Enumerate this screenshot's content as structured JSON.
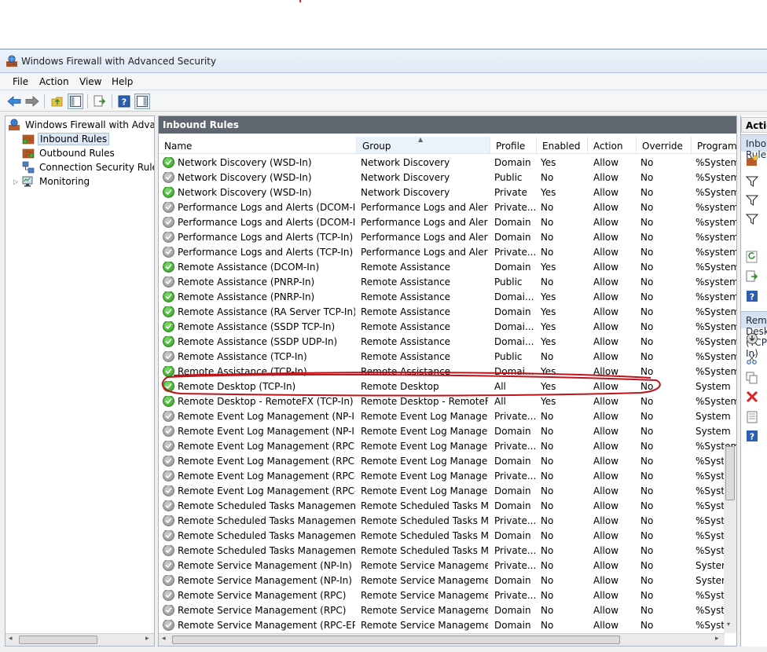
{
  "window": {
    "title": "Windows Firewall with Advanced Security"
  },
  "menu": [
    "File",
    "Action",
    "View",
    "Help"
  ],
  "tree": {
    "root": "Windows Firewall with Advanced Security on Local Computer",
    "items": [
      "Inbound Rules",
      "Outbound Rules",
      "Connection Security Rules",
      "Monitoring"
    ]
  },
  "main": {
    "header": "Inbound Rules",
    "columns": [
      "Name",
      "Group",
      "Profile",
      "Enabled",
      "Action",
      "Override",
      "Program"
    ]
  },
  "rows": [
    {
      "name": "Network Discovery (WSD-In)",
      "group": "Network Discovery",
      "profile": "Domain",
      "enabled": "Yes",
      "action": "Allow",
      "override": "No",
      "program": "%System"
    },
    {
      "name": "Network Discovery (WSD-In)",
      "group": "Network Discovery",
      "profile": "Public",
      "enabled": "No",
      "action": "Allow",
      "override": "No",
      "program": "%System"
    },
    {
      "name": "Network Discovery (WSD-In)",
      "group": "Network Discovery",
      "profile": "Private",
      "enabled": "Yes",
      "action": "Allow",
      "override": "No",
      "program": "%System"
    },
    {
      "name": "Performance Logs and Alerts (DCOM-In)",
      "group": "Performance Logs and Alerts",
      "profile": "Private...",
      "enabled": "No",
      "action": "Allow",
      "override": "No",
      "program": "%system"
    },
    {
      "name": "Performance Logs and Alerts (DCOM-In)",
      "group": "Performance Logs and Alerts",
      "profile": "Domain",
      "enabled": "No",
      "action": "Allow",
      "override": "No",
      "program": "%system"
    },
    {
      "name": "Performance Logs and Alerts (TCP-In)",
      "group": "Performance Logs and Alerts",
      "profile": "Domain",
      "enabled": "No",
      "action": "Allow",
      "override": "No",
      "program": "%system"
    },
    {
      "name": "Performance Logs and Alerts (TCP-In)",
      "group": "Performance Logs and Alerts",
      "profile": "Private...",
      "enabled": "No",
      "action": "Allow",
      "override": "No",
      "program": "%system"
    },
    {
      "name": "Remote Assistance (DCOM-In)",
      "group": "Remote Assistance",
      "profile": "Domain",
      "enabled": "Yes",
      "action": "Allow",
      "override": "No",
      "program": "%System"
    },
    {
      "name": "Remote Assistance (PNRP-In)",
      "group": "Remote Assistance",
      "profile": "Public",
      "enabled": "No",
      "action": "Allow",
      "override": "No",
      "program": "%system"
    },
    {
      "name": "Remote Assistance (PNRP-In)",
      "group": "Remote Assistance",
      "profile": "Domai...",
      "enabled": "Yes",
      "action": "Allow",
      "override": "No",
      "program": "%system"
    },
    {
      "name": "Remote Assistance (RA Server TCP-In)",
      "group": "Remote Assistance",
      "profile": "Domain",
      "enabled": "Yes",
      "action": "Allow",
      "override": "No",
      "program": "%System"
    },
    {
      "name": "Remote Assistance (SSDP TCP-In)",
      "group": "Remote Assistance",
      "profile": "Domai...",
      "enabled": "Yes",
      "action": "Allow",
      "override": "No",
      "program": "%System"
    },
    {
      "name": "Remote Assistance (SSDP UDP-In)",
      "group": "Remote Assistance",
      "profile": "Domai...",
      "enabled": "Yes",
      "action": "Allow",
      "override": "No",
      "program": "%System"
    },
    {
      "name": "Remote Assistance (TCP-In)",
      "group": "Remote Assistance",
      "profile": "Public",
      "enabled": "No",
      "action": "Allow",
      "override": "No",
      "program": "%System"
    },
    {
      "name": "Remote Assistance (TCP-In)",
      "group": "Remote Assistance",
      "profile": "Domai...",
      "enabled": "Yes",
      "action": "Allow",
      "override": "No",
      "program": "%System"
    },
    {
      "name": "Remote Desktop (TCP-In)",
      "group": "Remote Desktop",
      "profile": "All",
      "enabled": "Yes",
      "action": "Allow",
      "override": "No",
      "program": "System"
    },
    {
      "name": "Remote Desktop - RemoteFX (TCP-In)",
      "group": "Remote Desktop - RemoteFX",
      "profile": "All",
      "enabled": "Yes",
      "action": "Allow",
      "override": "No",
      "program": "%System"
    },
    {
      "name": "Remote Event Log Management (NP-In)",
      "group": "Remote Event Log Manage...",
      "profile": "Private...",
      "enabled": "No",
      "action": "Allow",
      "override": "No",
      "program": "System"
    },
    {
      "name": "Remote Event Log Management (NP-In)",
      "group": "Remote Event Log Manage...",
      "profile": "Domain",
      "enabled": "No",
      "action": "Allow",
      "override": "No",
      "program": "System"
    },
    {
      "name": "Remote Event Log Management (RPC)",
      "group": "Remote Event Log Manage...",
      "profile": "Private...",
      "enabled": "No",
      "action": "Allow",
      "override": "No",
      "program": "%System"
    },
    {
      "name": "Remote Event Log Management (RPC)",
      "group": "Remote Event Log Manage...",
      "profile": "Domain",
      "enabled": "No",
      "action": "Allow",
      "override": "No",
      "program": "%System"
    },
    {
      "name": "Remote Event Log Management (RPC-EP...",
      "group": "Remote Event Log Manage...",
      "profile": "Private...",
      "enabled": "No",
      "action": "Allow",
      "override": "No",
      "program": "%System"
    },
    {
      "name": "Remote Event Log Management (RPC-EP...",
      "group": "Remote Event Log Manage...",
      "profile": "Domain",
      "enabled": "No",
      "action": "Allow",
      "override": "No",
      "program": "%System"
    },
    {
      "name": "Remote Scheduled Tasks Management (...",
      "group": "Remote Scheduled Tasks M...",
      "profile": "Domain",
      "enabled": "No",
      "action": "Allow",
      "override": "No",
      "program": "%System"
    },
    {
      "name": "Remote Scheduled Tasks Management (...",
      "group": "Remote Scheduled Tasks M...",
      "profile": "Private...",
      "enabled": "No",
      "action": "Allow",
      "override": "No",
      "program": "%System"
    },
    {
      "name": "Remote Scheduled Tasks Management (...",
      "group": "Remote Scheduled Tasks M...",
      "profile": "Domain",
      "enabled": "No",
      "action": "Allow",
      "override": "No",
      "program": "%System"
    },
    {
      "name": "Remote Scheduled Tasks Management (...",
      "group": "Remote Scheduled Tasks M...",
      "profile": "Private...",
      "enabled": "No",
      "action": "Allow",
      "override": "No",
      "program": "%System"
    },
    {
      "name": "Remote Service Management (NP-In)",
      "group": "Remote Service Management",
      "profile": "Private...",
      "enabled": "No",
      "action": "Allow",
      "override": "No",
      "program": "System"
    },
    {
      "name": "Remote Service Management (NP-In)",
      "group": "Remote Service Management",
      "profile": "Domain",
      "enabled": "No",
      "action": "Allow",
      "override": "No",
      "program": "System"
    },
    {
      "name": "Remote Service Management (RPC)",
      "group": "Remote Service Management",
      "profile": "Private...",
      "enabled": "No",
      "action": "Allow",
      "override": "No",
      "program": "%System"
    },
    {
      "name": "Remote Service Management (RPC)",
      "group": "Remote Service Management",
      "profile": "Domain",
      "enabled": "No",
      "action": "Allow",
      "override": "No",
      "program": "%System"
    },
    {
      "name": "Remote Service Management (RPC-EPM...",
      "group": "Remote Service Management",
      "profile": "Domain",
      "enabled": "No",
      "action": "Allow",
      "override": "No",
      "program": "%System"
    }
  ],
  "actions": {
    "header": "Actions",
    "section_inbound": "Inbound Rules",
    "section_selected": "Remote Desktop (TCP-In)"
  },
  "colors": {
    "pane_header_bg": "#5e6670",
    "enabled_green": "#2f9a22",
    "disabled_gray": "#8a8a8a",
    "highlight_ink": "#c0141c"
  }
}
